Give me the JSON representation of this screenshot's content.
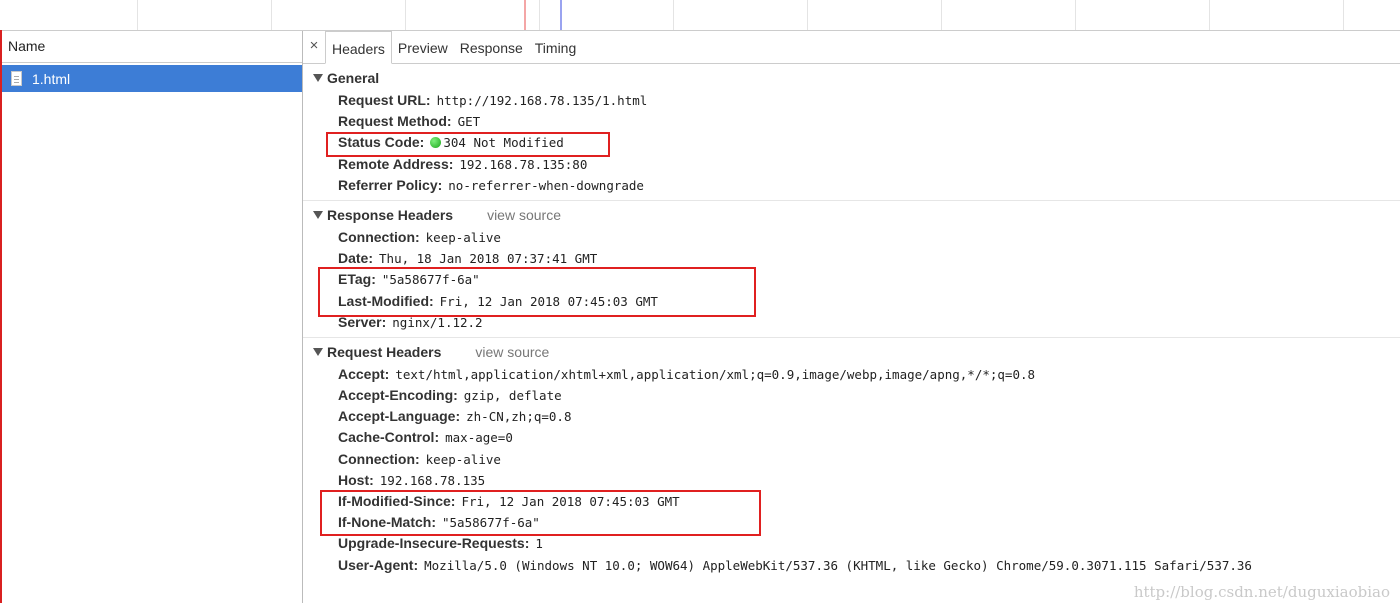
{
  "sidebar": {
    "name_header": "Name",
    "file": "1.html"
  },
  "tabs": [
    "Headers",
    "Preview",
    "Response",
    "Timing"
  ],
  "close_symbol": "×",
  "general": {
    "title": "General",
    "rows": [
      {
        "key": "Request URL:",
        "value": "http://192.168.78.135/1.html"
      },
      {
        "key": "Request Method:",
        "value": "GET"
      },
      {
        "key": "Status Code:",
        "value": "304 Not Modified"
      },
      {
        "key": "Remote Address:",
        "value": "192.168.78.135:80"
      },
      {
        "key": "Referrer Policy:",
        "value": "no-referrer-when-downgrade"
      }
    ]
  },
  "response_headers": {
    "title": "Response Headers",
    "view_source": "view source",
    "rows": [
      {
        "key": "Connection:",
        "value": "keep-alive"
      },
      {
        "key": "Date:",
        "value": "Thu, 18 Jan 2018 07:37:41 GMT"
      },
      {
        "key": "ETag:",
        "value": "\"5a58677f-6a\""
      },
      {
        "key": "Last-Modified:",
        "value": "Fri, 12 Jan 2018 07:45:03 GMT"
      },
      {
        "key": "Server:",
        "value": "nginx/1.12.2"
      }
    ]
  },
  "request_headers": {
    "title": "Request Headers",
    "view_source": "view source",
    "rows": [
      {
        "key": "Accept:",
        "value": "text/html,application/xhtml+xml,application/xml;q=0.9,image/webp,image/apng,*/*;q=0.8"
      },
      {
        "key": "Accept-Encoding:",
        "value": "gzip, deflate"
      },
      {
        "key": "Accept-Language:",
        "value": "zh-CN,zh;q=0.8"
      },
      {
        "key": "Cache-Control:",
        "value": "max-age=0"
      },
      {
        "key": "Connection:",
        "value": "keep-alive"
      },
      {
        "key": "Host:",
        "value": "192.168.78.135"
      },
      {
        "key": "If-Modified-Since:",
        "value": "Fri, 12 Jan 2018 07:45:03 GMT"
      },
      {
        "key": "If-None-Match:",
        "value": "\"5a58677f-6a\""
      },
      {
        "key": "Upgrade-Insecure-Requests:",
        "value": "1"
      },
      {
        "key": "User-Agent:",
        "value": "Mozilla/5.0 (Windows NT 10.0; WOW64) AppleWebKit/537.36 (KHTML, like Gecko) Chrome/59.0.3071.115 Safari/537.36"
      }
    ]
  },
  "watermark": "http://blog.csdn.net/duguxiaobiao",
  "colors": {
    "selection": "#3d7dd6",
    "highlight_box": "#e02020",
    "status_dot": "#1aa51a"
  },
  "icons": {
    "file": "document-icon",
    "status": "green-dot-icon",
    "collapse": "triangle-down-icon",
    "close": "close-icon"
  }
}
